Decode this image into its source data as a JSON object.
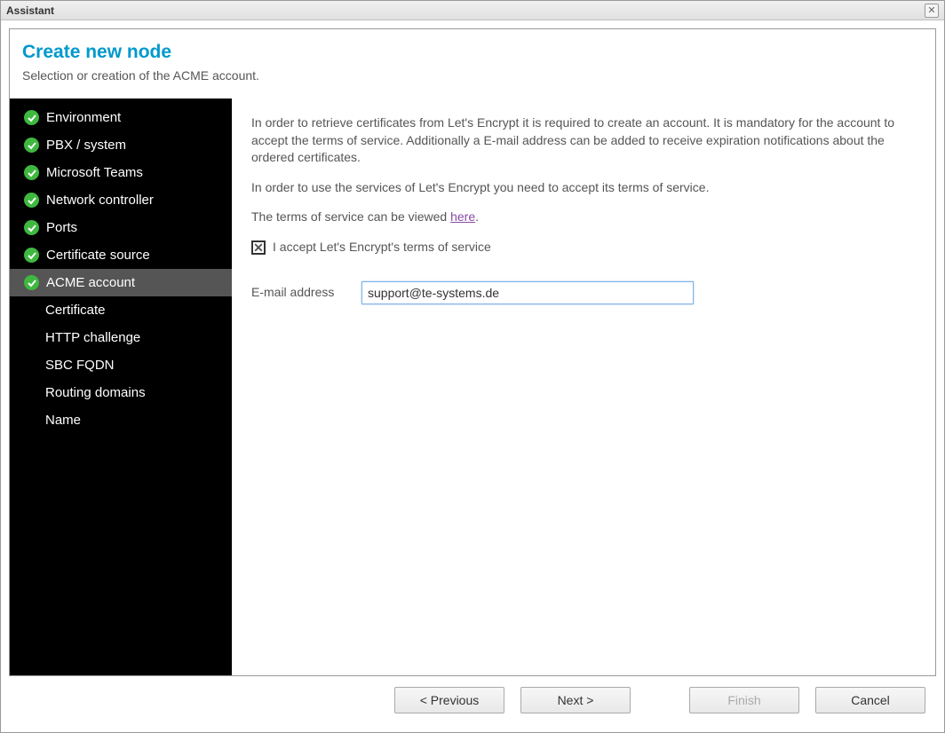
{
  "window": {
    "title": "Assistant"
  },
  "header": {
    "title": "Create new node",
    "subtitle": "Selection or creation of the ACME account."
  },
  "sidebar": {
    "items": [
      {
        "label": "Environment",
        "checked": true,
        "sub": false,
        "selected": false
      },
      {
        "label": "PBX / system",
        "checked": true,
        "sub": false,
        "selected": false
      },
      {
        "label": "Microsoft Teams",
        "checked": true,
        "sub": false,
        "selected": false
      },
      {
        "label": "Network controller",
        "checked": true,
        "sub": false,
        "selected": false
      },
      {
        "label": "Ports",
        "checked": true,
        "sub": false,
        "selected": false
      },
      {
        "label": "Certificate source",
        "checked": true,
        "sub": false,
        "selected": false
      },
      {
        "label": "ACME account",
        "checked": true,
        "sub": false,
        "selected": true
      },
      {
        "label": "Certificate",
        "checked": false,
        "sub": true,
        "selected": false
      },
      {
        "label": "HTTP challenge",
        "checked": false,
        "sub": true,
        "selected": false
      },
      {
        "label": "SBC FQDN",
        "checked": false,
        "sub": true,
        "selected": false
      },
      {
        "label": "Routing domains",
        "checked": false,
        "sub": true,
        "selected": false
      },
      {
        "label": "Name",
        "checked": false,
        "sub": true,
        "selected": false
      }
    ]
  },
  "main": {
    "paragraph1": "In order to retrieve certificates from Let's Encrypt it is required to create an account. It is mandatory for the account to accept the terms of service. Additionally a E-mail address can be added to receive expiration notifications about the ordered certificates.",
    "paragraph2": "In order to use the services of Let's Encrypt you need to accept its terms of service.",
    "tos_prefix": "The terms of service can be viewed ",
    "tos_link": "here",
    "tos_suffix": ".",
    "accept_label": "I accept Let's Encrypt's terms of service",
    "accept_checked": true,
    "email_label": "E-mail address",
    "email_value": "support@te-systems.de"
  },
  "buttons": {
    "previous": "< Previous",
    "next": "Next >",
    "finish": "Finish",
    "cancel": "Cancel"
  }
}
